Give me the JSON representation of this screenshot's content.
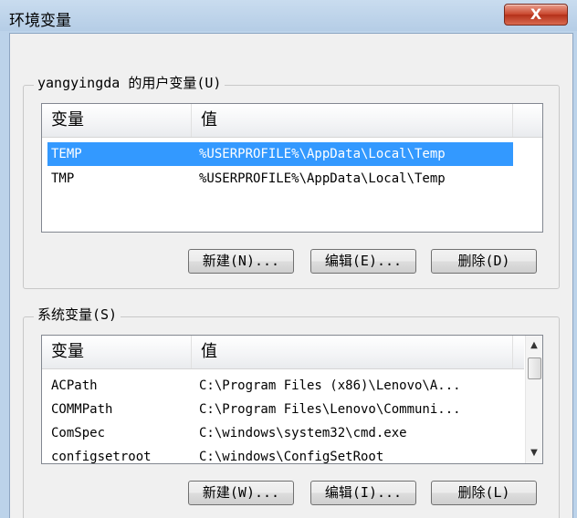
{
  "window": {
    "title": "环境变量",
    "close_glyph": "X"
  },
  "user_vars": {
    "group_label": "yangyingda 的用户变量(U)",
    "columns": [
      "变量",
      "值"
    ],
    "rows": [
      {
        "name": "TEMP",
        "value": "%USERPROFILE%\\AppData\\Local\\Temp",
        "selected": true
      },
      {
        "name": "TMP",
        "value": "%USERPROFILE%\\AppData\\Local\\Temp",
        "selected": false
      }
    ],
    "buttons": {
      "new": "新建(N)...",
      "edit": "编辑(E)...",
      "delete": "删除(D)"
    }
  },
  "system_vars": {
    "group_label": "系统变量(S)",
    "columns": [
      "变量",
      "值"
    ],
    "rows": [
      {
        "name": "ACPath",
        "value": "C:\\Program Files (x86)\\Lenovo\\A..."
      },
      {
        "name": "COMMPath",
        "value": "C:\\Program Files\\Lenovo\\Communi..."
      },
      {
        "name": "ComSpec",
        "value": "C:\\windows\\system32\\cmd.exe"
      },
      {
        "name": "configsetroot",
        "value": "C:\\windows\\ConfigSetRoot"
      }
    ],
    "buttons": {
      "new": "新建(W)...",
      "edit": "编辑(I)...",
      "delete": "删除(L)"
    }
  },
  "colors": {
    "selection": "#3399ff",
    "frame": "#bcd3ea",
    "close_button": "#c8452c"
  }
}
